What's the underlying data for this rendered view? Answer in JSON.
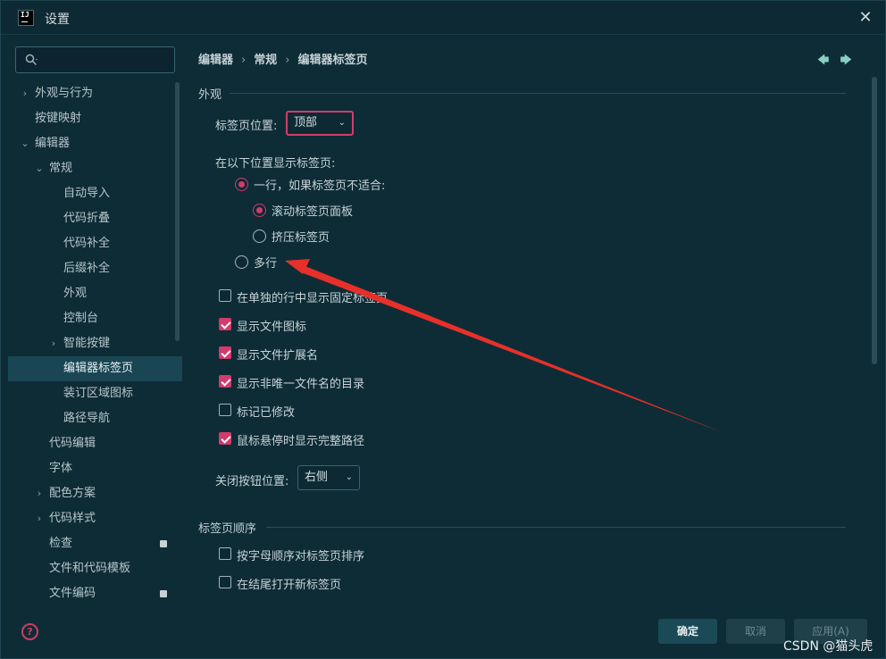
{
  "window": {
    "title": "设置",
    "close_glyph": "✕"
  },
  "search": {
    "placeholder": "",
    "icon": "search-icon"
  },
  "sidebar": {
    "items": [
      {
        "label": "外观与行为",
        "chevron": "›",
        "selected": false
      },
      {
        "label": "按键映射",
        "chevron": "",
        "selected": false
      },
      {
        "label": "编辑器",
        "chevron": "⌄",
        "selected": false
      },
      {
        "label": "常规",
        "chevron": "⌄",
        "selected": false
      },
      {
        "label": "自动导入",
        "chevron": "",
        "selected": false
      },
      {
        "label": "代码折叠",
        "chevron": "",
        "selected": false
      },
      {
        "label": "代码补全",
        "chevron": "",
        "selected": false
      },
      {
        "label": "后缀补全",
        "chevron": "",
        "selected": false
      },
      {
        "label": "外观",
        "chevron": "",
        "selected": false
      },
      {
        "label": "控制台",
        "chevron": "",
        "selected": false
      },
      {
        "label": "智能按键",
        "chevron": "›",
        "selected": false
      },
      {
        "label": "编辑器标签页",
        "chevron": "",
        "selected": true
      },
      {
        "label": "装订区域图标",
        "chevron": "",
        "selected": false
      },
      {
        "label": "路径导航",
        "chevron": "",
        "selected": false
      },
      {
        "label": "代码编辑",
        "chevron": "",
        "selected": false
      },
      {
        "label": "字体",
        "chevron": "",
        "selected": false
      },
      {
        "label": "配色方案",
        "chevron": "›",
        "selected": false
      },
      {
        "label": "代码样式",
        "chevron": "›",
        "selected": false
      },
      {
        "label": "检查",
        "chevron": "",
        "selected": false
      },
      {
        "label": "文件和代码模板",
        "chevron": "",
        "selected": false
      },
      {
        "label": "文件编码",
        "chevron": "",
        "selected": false
      }
    ],
    "help_glyph": "?"
  },
  "breadcrumb": {
    "items": [
      "编辑器",
      "常规",
      "编辑器标签页"
    ],
    "separator": "›"
  },
  "nav": {
    "back": "🡄",
    "forward": "🡆"
  },
  "appearance": {
    "title": "外观",
    "tab_position_label": "标签页位置:",
    "tab_position_value": "顶部",
    "show_tabs_label": "在以下位置显示标签页:",
    "radio_single_row": "一行，如果标签页不适合:",
    "radio_scroll": "滚动标签页面板",
    "radio_squeeze": "挤压标签页",
    "radio_multi_row": "多行",
    "checkboxes": [
      {
        "label": "在单独的行中显示固定标签页",
        "checked": false
      },
      {
        "label": "显示文件图标",
        "checked": true
      },
      {
        "label": "显示文件扩展名",
        "checked": true
      },
      {
        "label": "显示非唯一文件名的目录",
        "checked": true
      },
      {
        "label": "标记已修改",
        "checked": false
      },
      {
        "label": "鼠标悬停时显示完整路径",
        "checked": true
      }
    ],
    "close_button_label": "关闭按钮位置:",
    "close_button_value": "右侧"
  },
  "order": {
    "title": "标签页顺序",
    "checkboxes": [
      {
        "label": "按字母顺序对标签页排序",
        "checked": false
      },
      {
        "label": "在结尾打开新标签页",
        "checked": false
      }
    ]
  },
  "buttons": {
    "ok": "确定",
    "cancel": "取消",
    "apply": "应用(A)"
  },
  "watermark": "CSDN @猫头虎",
  "colors": {
    "accent": "#d23b6b",
    "annotation_arrow": "#e8302a",
    "background": "#0e2c36"
  }
}
